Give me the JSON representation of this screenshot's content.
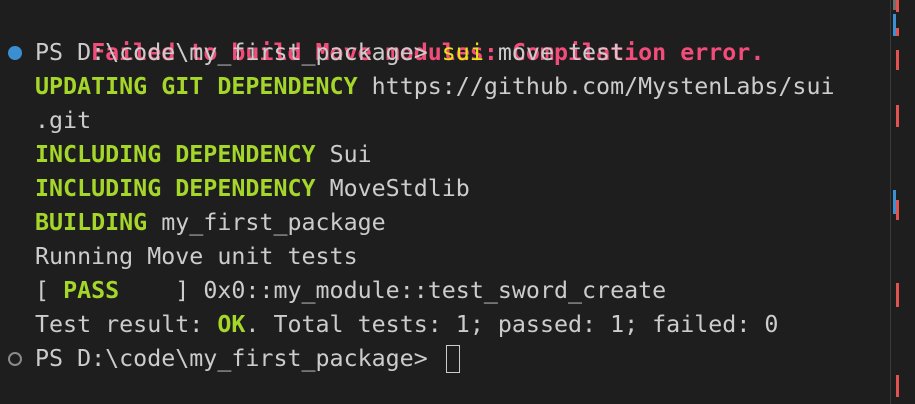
{
  "terminal": {
    "error_line": "Failed to build Move modules: Compilation error.",
    "prompt": "PS D:\\code\\my_first_package>",
    "command_name": "sui",
    "command_args": "move test",
    "updating_label": "UPDATING GIT DEPENDENCY",
    "updating_url_part1": "https://github.com/MystenLabs/sui",
    "updating_url_part2": ".git",
    "including_label": "INCLUDING DEPENDENCY",
    "dependency_1": "Sui",
    "dependency_2": "MoveStdlib",
    "building_label": "BUILDING",
    "building_target": "my_first_package",
    "running_line": "Running Move unit tests",
    "pass_open": "[ ",
    "pass_label": "PASS",
    "pass_close": "    ] ",
    "pass_test": "0x0::my_module::test_sword_create",
    "result_label": "Test result: ",
    "result_status": "OK",
    "result_summary": ". Total tests: 1; passed: 1; failed: 0",
    "final_prompt": "PS D:\\code\\my_first_package>"
  },
  "colors": {
    "background": "#1e1e1e",
    "error": "#f14c7a",
    "success_green": "#a5d62a",
    "command_yellow": "#e5e510",
    "text": "#cccccc",
    "decoration_blue": "#3b8fd0",
    "scroll_mark_red": "#e2534f",
    "scroll_mark_blue": "#3d8fd6"
  },
  "icons": {
    "command_done": "circle-filled-icon",
    "command_idle": "circle-outline-icon",
    "cursor": "block-cursor"
  }
}
